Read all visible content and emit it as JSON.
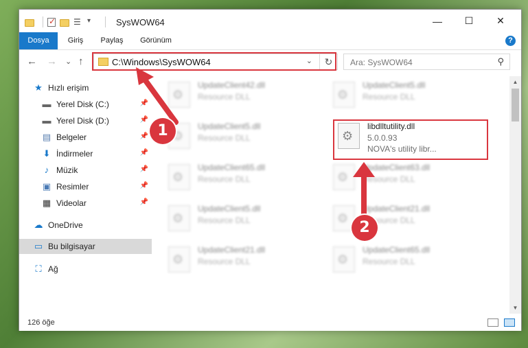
{
  "window": {
    "title": "SysWOW64",
    "controls": {
      "minimize": "—",
      "maximize": "☐",
      "close": "✕"
    }
  },
  "ribbon": {
    "tabs": [
      "Dosya",
      "Giriş",
      "Paylaş",
      "Görünüm"
    ],
    "help": "?"
  },
  "nav": {
    "back": "←",
    "forward": "→",
    "recent": "⌄",
    "up": "↑",
    "address": "C:\\Windows\\SysWOW64",
    "search_placeholder": "Ara: SysWOW64"
  },
  "sidebar": {
    "items": [
      {
        "label": "Hızlı erişim",
        "icon": "star-icon"
      },
      {
        "label": "Yerel Disk (C:)",
        "icon": "drive-icon"
      },
      {
        "label": "Yerel Disk (D:)",
        "icon": "drive-icon"
      },
      {
        "label": "Belgeler",
        "icon": "documents-icon"
      },
      {
        "label": "İndirmeler",
        "icon": "download-icon"
      },
      {
        "label": "Müzik",
        "icon": "music-icon"
      },
      {
        "label": "Resimler",
        "icon": "pictures-icon"
      },
      {
        "label": "Videolar",
        "icon": "videos-icon"
      },
      {
        "label": "OneDrive",
        "icon": "cloud-icon"
      },
      {
        "label": "Bu bilgisayar",
        "icon": "computer-icon"
      },
      {
        "label": "Ağ",
        "icon": "network-icon"
      }
    ]
  },
  "files": [
    {
      "name": "UpdateClient42.dll",
      "desc": "Resource DLL"
    },
    {
      "name": "UpdateClient5.dll",
      "desc": "Resource DLL"
    },
    {
      "name": "UpdateClient5.dll",
      "desc": "Resource DLL"
    },
    {
      "name": "libdlltutility.dll",
      "version": "5.0.0.93",
      "desc": "NOVA's utility libr..."
    },
    {
      "name": "UpdateClient65.dll",
      "desc": "Resource DLL"
    },
    {
      "name": "UpdateClient63.dll",
      "desc": "Resource DLL"
    },
    {
      "name": "UpdateClient5.dll",
      "desc": "Resource DLL"
    },
    {
      "name": "UpdateClient21.dll",
      "desc": "Resource DLL"
    },
    {
      "name": "UpdateClient21.dll",
      "desc": "Resource DLL"
    },
    {
      "name": "UpdateClient65.dll",
      "desc": "Resource DLL"
    }
  ],
  "status": {
    "count": "126 öğe"
  },
  "annotations": {
    "step1": "1",
    "step2": "2"
  },
  "colors": {
    "accent": "#1979ca",
    "highlight": "#d9363e"
  }
}
